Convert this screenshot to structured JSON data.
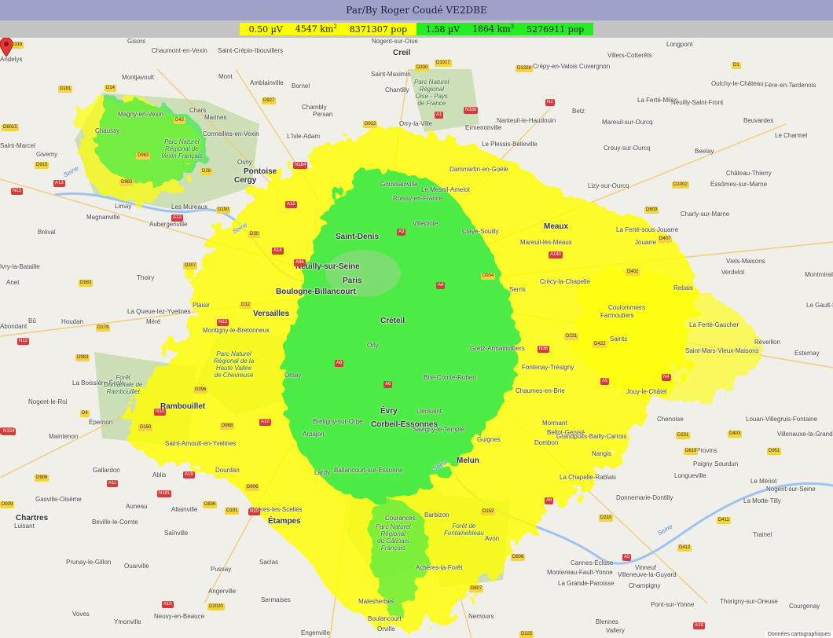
{
  "title": "Par/By Roger Coudé VE2DBE",
  "legend": [
    {
      "level": "0.50 µV",
      "area": "4547 km",
      "area_sup": "2",
      "pop": "8371307 pop",
      "color": "#ffff00"
    },
    {
      "level": "1.58 µV",
      "area": "1864 km",
      "area_sup": "2",
      "pop": "5276911 pop",
      "color": "#22ee22"
    }
  ],
  "attribution": "Données cartographiques",
  "places": [
    {
      "t": "Gisors"
    },
    {
      "t": "Chaumont-en-Vexin"
    },
    {
      "t": "Saint-Crépin-Ibouvillers"
    },
    {
      "t": "Nogent-sur-Oise"
    },
    {
      "t": "Creil"
    },
    {
      "t": "Crépy-en-Valois"
    },
    {
      "t": "Villers-Cotterêts"
    },
    {
      "t": "Longpont"
    },
    {
      "t": "Andelys"
    },
    {
      "t": "Montjavoult"
    },
    {
      "t": "Mont"
    },
    {
      "t": "Amblainville"
    },
    {
      "t": "Bornel"
    },
    {
      "t": "Saint-Maximin"
    },
    {
      "t": "Cuvergnon"
    },
    {
      "t": "Oulchy-le-Château"
    },
    {
      "t": "Fère-en-Tardenois"
    },
    {
      "t": "Chantilly"
    },
    {
      "t": "Chambly"
    },
    {
      "t": "Persan"
    },
    {
      "t": "Chars"
    },
    {
      "t": "Magny-en-Vexin"
    },
    {
      "t": "Marines"
    },
    {
      "t": "Betz"
    },
    {
      "t": "La Ferté-Milon"
    },
    {
      "t": "Neuilly-Saint-Front"
    },
    {
      "t": "Nanteuil-le-Haudouin"
    },
    {
      "t": "Mareuil-sur-Ourcq"
    },
    {
      "t": "Beuvardes"
    },
    {
      "t": "Chaussy"
    },
    {
      "t": "Cormeilles-en-Vexin"
    },
    {
      "t": "L'Isle-Adam"
    },
    {
      "t": "Orry-la-Ville"
    },
    {
      "t": "Ermenonville"
    },
    {
      "t": "Le Charmel"
    },
    {
      "t": "Saint-Marcel"
    },
    {
      "t": "Le Plessis-Belleville"
    },
    {
      "t": "Crouy-sur-Ourcq"
    },
    {
      "t": "Givemy"
    },
    {
      "t": "Osny"
    },
    {
      "t": "Beelay"
    },
    {
      "t": "Pontoise"
    },
    {
      "t": "Dammartin-en-Goële"
    },
    {
      "t": "Château-Thierry"
    },
    {
      "t": "Cergy"
    },
    {
      "t": "Goussainville"
    },
    {
      "t": "Le Mesnil-Amelot"
    },
    {
      "t": "Lizy-sur-Ourcq"
    },
    {
      "t": "Essômes-sur-Marne"
    },
    {
      "t": "Roissy-en-France"
    },
    {
      "t": "Limay"
    },
    {
      "t": "Magnanville"
    },
    {
      "t": "Les Mureaux"
    },
    {
      "t": "Villepinte"
    },
    {
      "t": "Charly-sur-Marne"
    },
    {
      "t": "Aubergenville"
    },
    {
      "t": "Meaux"
    },
    {
      "t": "Bréval"
    },
    {
      "t": "Saint-Denis"
    },
    {
      "t": "Claye-Souilly"
    },
    {
      "t": "La Ferté-sous-Jouarre"
    },
    {
      "t": "Mareuil-lès-Meaux"
    },
    {
      "t": "Jouarre"
    },
    {
      "t": "Viels-Maisons"
    },
    {
      "t": "Ivry-la-Bataille"
    },
    {
      "t": "Neuilly-sur-Seine"
    },
    {
      "t": "Verdelot"
    },
    {
      "t": "Montmirail"
    },
    {
      "t": "Anet"
    },
    {
      "t": "Thoiry"
    },
    {
      "t": "Crécy-la-Chapelle"
    },
    {
      "t": "Rebais"
    },
    {
      "t": "Boulogne-Billancourt"
    },
    {
      "t": "Serris"
    },
    {
      "t": "Plaisir"
    },
    {
      "t": "Coulommiers"
    },
    {
      "t": "Le Gault-Soigny"
    },
    {
      "t": "La Queue-lez-Yvelines"
    },
    {
      "t": "Versailles"
    },
    {
      "t": "Farmoutiers"
    },
    {
      "t": "Bû"
    },
    {
      "t": "Houdan"
    },
    {
      "t": "Méré"
    },
    {
      "t": "Créteil"
    },
    {
      "t": "La Ferté-Gaucher"
    },
    {
      "t": "Abondant"
    },
    {
      "t": "Montigny-le-Bretonneux"
    },
    {
      "t": "Saints"
    },
    {
      "t": "Réveillon"
    },
    {
      "t": "Gretz-Armainvilliers"
    },
    {
      "t": "Saint-Mars-Vieux-Maisons"
    },
    {
      "t": "Esternay"
    },
    {
      "t": "Orly"
    },
    {
      "t": "Fontenay-Trésigny"
    },
    {
      "t": "Brie-Comte-Robert"
    },
    {
      "t": "Orsay"
    },
    {
      "t": "La Boissière-École"
    },
    {
      "t": "Chaumes-en-Brie"
    },
    {
      "t": "Jouy-le-Châtel"
    },
    {
      "t": "Nogent-le-Roi"
    },
    {
      "t": "Rambouillet"
    },
    {
      "t": "Évry"
    },
    {
      "t": "Lieusaint"
    },
    {
      "t": "Mormant"
    },
    {
      "t": "Chenoise"
    },
    {
      "t": "Louan-Villegruis-Fontaine"
    },
    {
      "t": "Bretigny-sur-Orge"
    },
    {
      "t": "Corbeil-Essonnes"
    },
    {
      "t": "Bellot-Genisé"
    },
    {
      "t": "Épernon"
    },
    {
      "t": "Savigny-le-Temple"
    },
    {
      "t": "Villenauxe-la-Grande"
    },
    {
      "t": "Maintenon"
    },
    {
      "t": "Arpajon"
    },
    {
      "t": "Guignes"
    },
    {
      "t": "Grandpuits-Bailly-Carrois"
    },
    {
      "t": "Saint-Arnoult-en-Yvelines"
    },
    {
      "t": "Dombon"
    },
    {
      "t": "Nangis"
    },
    {
      "t": "Provins"
    },
    {
      "t": "Melun"
    },
    {
      "t": "Gallardon"
    },
    {
      "t": "Ablis"
    },
    {
      "t": "Dourdan"
    },
    {
      "t": "Lardy"
    },
    {
      "t": "Ballancourt-sur-Essonne"
    },
    {
      "t": "Poigny"
    },
    {
      "t": "Sourdun"
    },
    {
      "t": "Longueville"
    },
    {
      "t": "La Chapelle-Rablais"
    },
    {
      "t": "Le Mériot"
    },
    {
      "t": "Nogent-sur-Seine"
    },
    {
      "t": "Gasville-Oisème"
    },
    {
      "t": "Auneau"
    },
    {
      "t": "Donnemarie-Dontilly"
    },
    {
      "t": "La Motte-Tilly"
    },
    {
      "t": "Chartres"
    },
    {
      "t": "Allainville"
    },
    {
      "t": "Brières-les-Scellés"
    },
    {
      "t": "Luisant"
    },
    {
      "t": "Beville-le-Comte"
    },
    {
      "t": "Étampes"
    },
    {
      "t": "Courances"
    },
    {
      "t": "Barbizon"
    },
    {
      "t": "Saînville"
    },
    {
      "t": "Avon"
    },
    {
      "t": "Trainel"
    },
    {
      "t": "Prunay-le-Gillon"
    },
    {
      "t": "Ouarville"
    },
    {
      "t": "Pussay"
    },
    {
      "t": "Saclas"
    },
    {
      "t": "Montereau-Fault-Yonne"
    },
    {
      "t": "Achères-la-Forêt"
    },
    {
      "t": "Cannes-Écluse"
    },
    {
      "t": "Vinneuf"
    },
    {
      "t": "Angerville"
    },
    {
      "t": "La Grande-Paroisse"
    },
    {
      "t": "Villeneuve-la-Guyard"
    },
    {
      "t": "Champigny"
    },
    {
      "t": "Sermaises"
    },
    {
      "t": "Malesherbes"
    },
    {
      "t": "Voves"
    },
    {
      "t": "Ymonville"
    },
    {
      "t": "Thorigny-sur-Oreuse"
    },
    {
      "t": "Courgenay"
    },
    {
      "t": "Pont-sur-Yonne"
    },
    {
      "t": "Nemours"
    },
    {
      "t": "Neuvy-en-Beauce"
    },
    {
      "t": "Engenville"
    },
    {
      "t": "Boulancourt"
    },
    {
      "t": "Orville"
    },
    {
      "t": "Blennes"
    },
    {
      "t": "Vallery"
    },
    {
      "t": "Paris"
    },
    {
      "t": "Seine"
    },
    {
      "t": "Seine"
    },
    {
      "t": "Seine"
    },
    {
      "t": "Seine"
    }
  ],
  "parks": [
    {
      "t": "Parc Naturel\nRégional de\nVexin Français"
    },
    {
      "t": "Parc Naturel\nRégional\nOise - Pays\nde France"
    },
    {
      "t": "Parc Naturel\nRégional de la\nHaute Vallée\nde Chevreuse"
    },
    {
      "t": "Forêt\nDomaniale de\nRambouillet"
    },
    {
      "t": "Parc Naturel\nRégional\ndu Gâtinais\nFrançais"
    },
    {
      "t": "Forêt de\nFontainebleau"
    }
  ],
  "roads": [
    {
      "t": "D316"
    },
    {
      "t": "D181"
    },
    {
      "t": "D14"
    },
    {
      "t": "D927"
    },
    {
      "t": "D1017"
    },
    {
      "t": "D1324"
    },
    {
      "t": "N2"
    },
    {
      "t": "D1"
    },
    {
      "t": "D6015"
    },
    {
      "t": "D42"
    },
    {
      "t": "D922"
    },
    {
      "t": "D330"
    },
    {
      "t": "N330"
    },
    {
      "t": "A1"
    },
    {
      "t": "D983"
    },
    {
      "t": "D28"
    },
    {
      "t": "D915"
    },
    {
      "t": "A13"
    },
    {
      "t": "N184"
    },
    {
      "t": "A15"
    },
    {
      "t": "N13"
    },
    {
      "t": "D983"
    },
    {
      "t": "D190"
    },
    {
      "t": "A13"
    },
    {
      "t": "A14"
    },
    {
      "t": "D30"
    },
    {
      "t": "A86"
    },
    {
      "t": "A3"
    },
    {
      "t": "A140"
    },
    {
      "t": "D407"
    },
    {
      "t": "D1002"
    },
    {
      "t": "D603"
    },
    {
      "t": "D307"
    },
    {
      "t": "D983"
    },
    {
      "t": "D402"
    },
    {
      "t": "D934"
    },
    {
      "t": "D12"
    },
    {
      "t": "D179"
    },
    {
      "t": "N12"
    },
    {
      "t": "A4"
    },
    {
      "t": "D231"
    },
    {
      "t": "D422"
    },
    {
      "t": "N12"
    },
    {
      "t": "D983"
    },
    {
      "t": "A6"
    },
    {
      "t": "A6"
    },
    {
      "t": "N36"
    },
    {
      "t": "A5"
    },
    {
      "t": "N4"
    },
    {
      "t": "D396"
    },
    {
      "t": "N10"
    },
    {
      "t": "D906"
    },
    {
      "t": "D4"
    },
    {
      "t": "D150"
    },
    {
      "t": "D988"
    },
    {
      "t": "N104"
    },
    {
      "t": "D231"
    },
    {
      "t": "D403"
    },
    {
      "t": "D619"
    },
    {
      "t": "D951"
    },
    {
      "t": "A10"
    },
    {
      "t": "A11"
    },
    {
      "t": "A19"
    },
    {
      "t": "D906"
    },
    {
      "t": "N191"
    },
    {
      "t": "D836"
    },
    {
      "t": "N20"
    },
    {
      "t": "D191"
    },
    {
      "t": "D152"
    },
    {
      "t": "D607"
    },
    {
      "t": "A6"
    },
    {
      "t": "A5"
    },
    {
      "t": "D412"
    },
    {
      "t": "D606"
    },
    {
      "t": "A19"
    },
    {
      "t": "D225"
    },
    {
      "t": "D2020"
    },
    {
      "t": "A10"
    },
    {
      "t": "N154"
    },
    {
      "t": "D939"
    },
    {
      "t": "D411"
    },
    {
      "t": "D210"
    }
  ]
}
